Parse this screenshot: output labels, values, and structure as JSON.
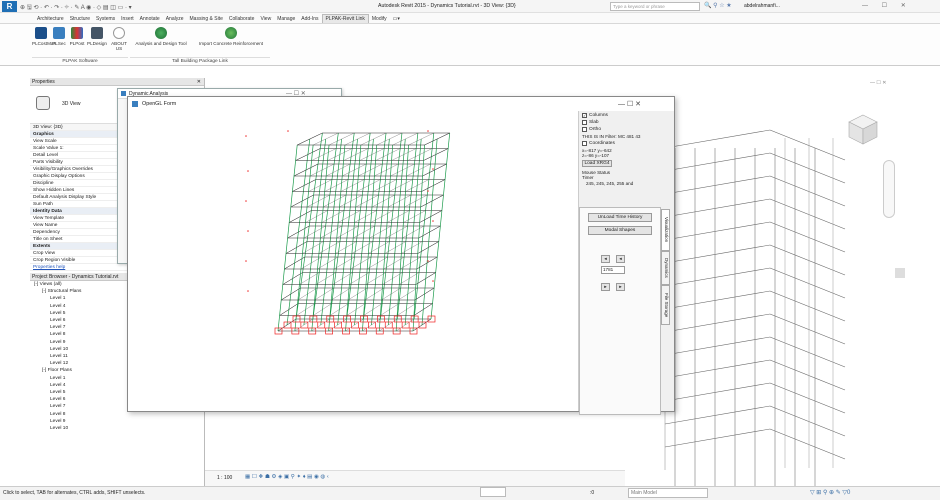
{
  "titlebar": {
    "quick_access": "⊕ 🖫 ⟲ · ↶ · ↷ · ⌖ · ✎ A ◉ · ◇ ▤ ◫ ▭ · ▾",
    "title": "Autodesk Revit 2015 -  Dynamics Tutorial.rvt - 3D View: {3D}",
    "search_placeholder": "Type a keyword or phrase",
    "user": "abdelrahmanfi...",
    "window_controls": "—  ☐  ✕"
  },
  "ribbon": {
    "tabs": [
      "Architecture",
      "Structure",
      "Systems",
      "Insert",
      "Annotate",
      "Analyze",
      "Massing & Site",
      "Collaborate",
      "View",
      "Manage",
      "Add-Ins",
      "PLPAK-Revit Link",
      "Modify",
      "▭▾"
    ],
    "active_tab": "PLPAK-Revit Link",
    "buttons": [
      "PLCostMan",
      "PLSec",
      "PLPost",
      "PLDesign",
      "ABOUT US",
      "Analysis and Design Tool",
      "Import Concrete Reinforcement"
    ],
    "groups": [
      "PLPAK Software",
      "Tall Building Package Link"
    ]
  },
  "properties": {
    "title": "Properties",
    "close": "✕",
    "type_name": "3D View",
    "view_selector": "3D View: {3D}",
    "rows": [
      [
        "Graphics",
        ""
      ],
      [
        "View Scale",
        ""
      ],
      [
        "Scale Value    1:",
        ""
      ],
      [
        "Detail Level",
        ""
      ],
      [
        "Parts Visibility",
        ""
      ],
      [
        "Visibility/Graphics Overrides",
        ""
      ],
      [
        "Graphic Display Options",
        ""
      ],
      [
        "Discipline",
        ""
      ],
      [
        "Show Hidden Lines",
        ""
      ],
      [
        "Default Analysis Display Style",
        ""
      ],
      [
        "Sun Path",
        ""
      ],
      [
        "Identity Data",
        ""
      ],
      [
        "View Template",
        ""
      ],
      [
        "View Name",
        ""
      ],
      [
        "Dependency",
        ""
      ],
      [
        "Title on Sheet",
        ""
      ],
      [
        "Extents",
        ""
      ],
      [
        "Crop View",
        ""
      ],
      [
        "Crop Region Visible",
        ""
      ]
    ],
    "help": "Properties help"
  },
  "browser": {
    "title": "Project Browser - Dynamics Tutorial.rvt",
    "items": [
      "[-] Views (all)",
      "[-] Structural Plans",
      "Level 1",
      "Level 4",
      "Level 5",
      "Level 6",
      "Level 7",
      "Level 8",
      "Level 9",
      "Level 10",
      "Level 11",
      "Level 12",
      "[-] Floor Plans",
      "Level 1",
      "Level 4",
      "Level 5",
      "Level 6",
      "Level 7",
      "Level 8",
      "Level 9",
      "Level 10"
    ]
  },
  "dynamic": {
    "title": "Dynamic Analysis",
    "controls": "—     ☐     ✕"
  },
  "opensees": {
    "title": "OpenGL Form",
    "controls": "—     ☐     ✕",
    "chk": [
      {
        "label": "Columns",
        "checked": true
      },
      {
        "label": "Slab",
        "checked": false
      },
      {
        "label": "Ortho",
        "checked": false
      }
    ],
    "info": "THIS IS IN Filter: MC  481   43",
    "coords_label": "Coordinates",
    "coords": "x=-817 y=-642\nz=-86 y=-107",
    "load_btn": "Load XRG4",
    "mouse": "Mouse Status\nTimer",
    "mouse_val": "245, 245, 245, 255 and",
    "unload_btn": "UnLoad Time History",
    "modal_btn": "Modal Shapes",
    "nav": [
      "◄",
      "◄",
      "►",
      "►"
    ],
    "frame": "1781",
    "vtabs": [
      "Visualization",
      "Dynamics",
      "File Storage"
    ]
  },
  "viewbar": {
    "scale": "1 : 100",
    "icons": "▦ ☐ ❖ ☗ ⚙ ◈ ▣ ⚲ ✦ ♦ ▤ ◉ ◍ ‹"
  },
  "status": {
    "text": "Click to select, TAB for alternates, CTRL adds, SHIFT unselects.",
    "zero": ":0",
    "model": "Main Model",
    "right_icons": "▽ ⊞ ⚲ ⊕ ✎ ▽0"
  },
  "canvas": {
    "nav_icons": "— ☐ ✕",
    "viewcube": "▣"
  }
}
